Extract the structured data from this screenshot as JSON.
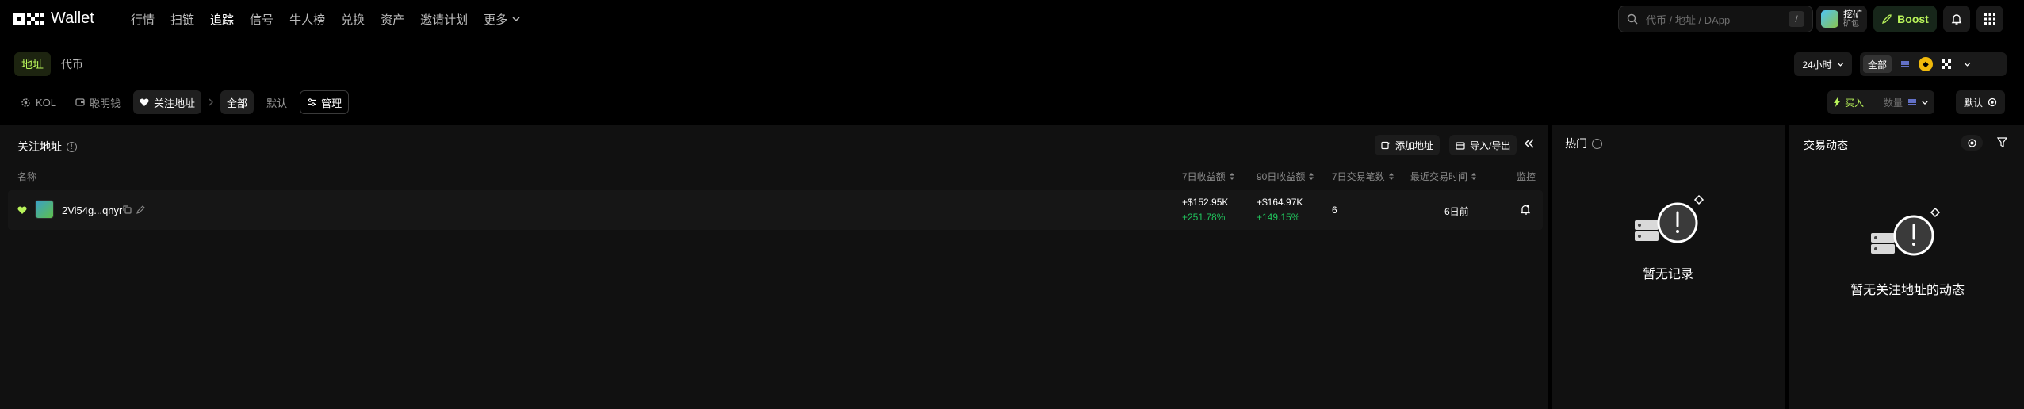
{
  "nav": {
    "logo_text": "Wallet",
    "items": [
      "行情",
      "扫链",
      "追踪",
      "信号",
      "牛人榜",
      "兑换",
      "资产",
      "邀请计划"
    ],
    "active": "追踪",
    "more": "更多"
  },
  "search": {
    "placeholder": "代币 / 地址 / DApp",
    "shortcut": "/"
  },
  "mine": {
    "title": "挖矿",
    "subtitle": "矿包"
  },
  "boost": {
    "label": "Boost"
  },
  "tabs": {
    "address": "地址",
    "token": "代币"
  },
  "time_select": "24小时",
  "chain": {
    "all": "全部"
  },
  "filters": {
    "kol": "KOL",
    "smart_money": "聪明钱",
    "watch": "关注地址",
    "all": "全部",
    "default": "默认",
    "manage": "管理"
  },
  "buy_box": {
    "buy": "买入",
    "qty_placeholder": "数量"
  },
  "sort_default": "默认",
  "main_panel": {
    "title": "关注地址",
    "add_button": "添加地址",
    "import_button": "导入/导出",
    "columns": {
      "name": "名称",
      "pnl7": "7日收益额",
      "pnl90": "90日收益额",
      "tx7": "7日交易笔数",
      "last_tx": "最近交易时间",
      "monitor": "监控"
    },
    "rows": [
      {
        "name": "2Vi54g...qnyr",
        "pnl7": "+$152.95K",
        "pnl7_pct": "+251.78%",
        "pnl90": "+$164.97K",
        "pnl90_pct": "+149.15%",
        "tx7": "6",
        "last_tx": "6日前"
      }
    ]
  },
  "hot_panel": {
    "title": "热门",
    "empty": "暂无记录"
  },
  "feed_panel": {
    "title": "交易动态",
    "empty": "暂无关注地址的动态"
  },
  "colors": {
    "accent": "#b8f35a",
    "positive": "#21c55d",
    "panel": "#111111"
  }
}
